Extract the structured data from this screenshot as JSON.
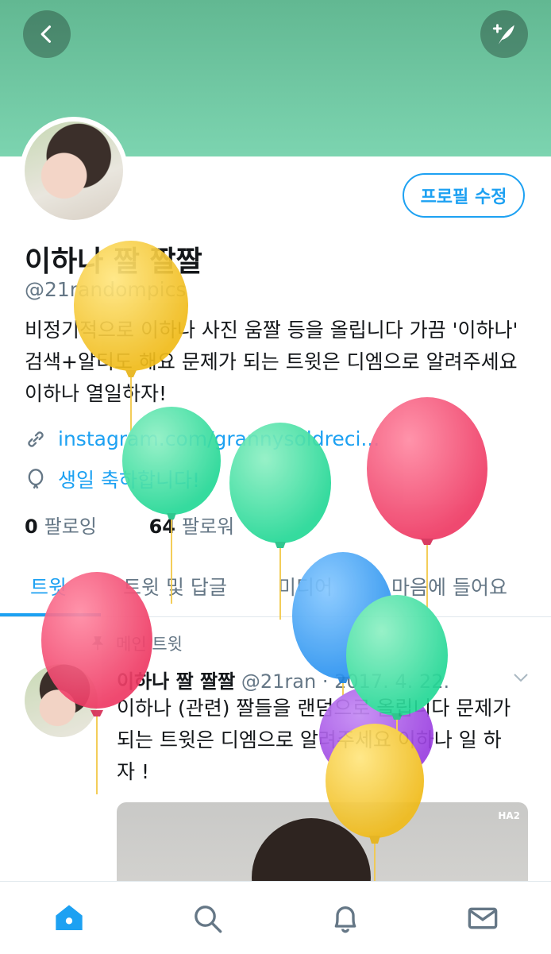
{
  "header": {
    "back_icon": "back-arrow-icon",
    "compose_icon": "compose-tweet-icon",
    "banner_color": "#72c9a3"
  },
  "profile": {
    "name": "이하나 짤 짤짤",
    "handle": "@21randompics",
    "edit_button": "프로필 수정",
    "bio": "비정기적으로 이하나 사진 움짤 등을 올립니다 가끔 '이하나' 검색+알티도 해요 문제가 되는 트윗은 디엠으로 알려주세요 이하나 열일하자!",
    "link": "instagram.com/grannysoldreci...",
    "birthday": "생일 축하합니다!",
    "following_count": "0",
    "following_label": "팔로잉",
    "followers_count": "64",
    "followers_label": "팔로워"
  },
  "tabs": [
    {
      "label": "트윗"
    },
    {
      "label": "트윗 및 답글"
    },
    {
      "label": "미디어"
    },
    {
      "label": "마음에 들어요"
    }
  ],
  "tweet": {
    "pinned_label": "메인 트윗",
    "author": "이하나 짤 짤짤",
    "handle": "@21ran",
    "date": "· 2017. 4. 22.",
    "text": "이하나 (관련) 짤들을 랜덤으로 올립니다 문제가 되는 트윗은 디엠으로 알려주세요 이하나 일 하 자 !",
    "media_watermark": "HA2"
  },
  "nav": [
    "home-icon",
    "search-icon",
    "notifications-icon",
    "messages-icon"
  ],
  "colors": {
    "accent": "#1da1f2",
    "muted": "#657786"
  }
}
